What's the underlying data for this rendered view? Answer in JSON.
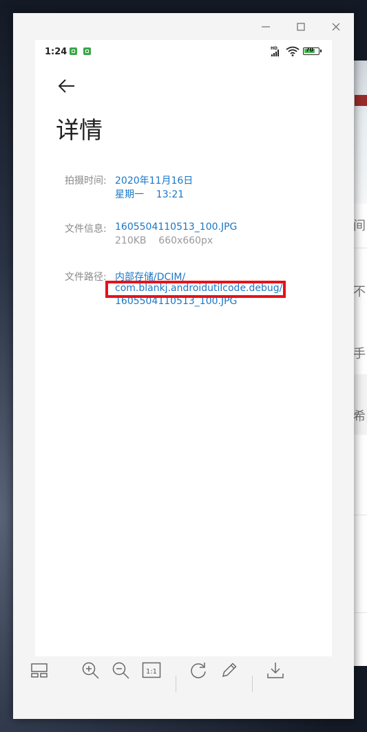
{
  "phone": {
    "status": {
      "time": "1:24",
      "battery": "70",
      "network": "HD"
    },
    "page": {
      "title": "详情",
      "rows": [
        {
          "label": "拍摄时间:",
          "lines": [
            "2020年11月16日",
            "星期一    13:21"
          ]
        },
        {
          "label": "文件信息:",
          "lines": [
            "1605504110513_100.JPG",
            "210KB    660x660px"
          ]
        },
        {
          "label": "文件路径:",
          "lines": [
            "内部存储/DCIM/",
            "com.blankj.androidutilcode.debug/",
            "1605504110513_100.JPG"
          ]
        }
      ]
    }
  },
  "background_window": {
    "glyphs": [
      "间",
      "不",
      "手",
      "希"
    ]
  },
  "toolbar": {
    "icons": [
      "thumbnail-strip-icon",
      "zoom-in-icon",
      "zoom-out-icon",
      "actual-size-icon",
      "rotate-icon",
      "edit-icon",
      "download-icon"
    ],
    "actual_size_label": "1:1"
  },
  "colors": {
    "link": "#1976c5",
    "label": "#888888",
    "highlight": "#e6121a",
    "battery_fill": "#3fbf4a"
  }
}
